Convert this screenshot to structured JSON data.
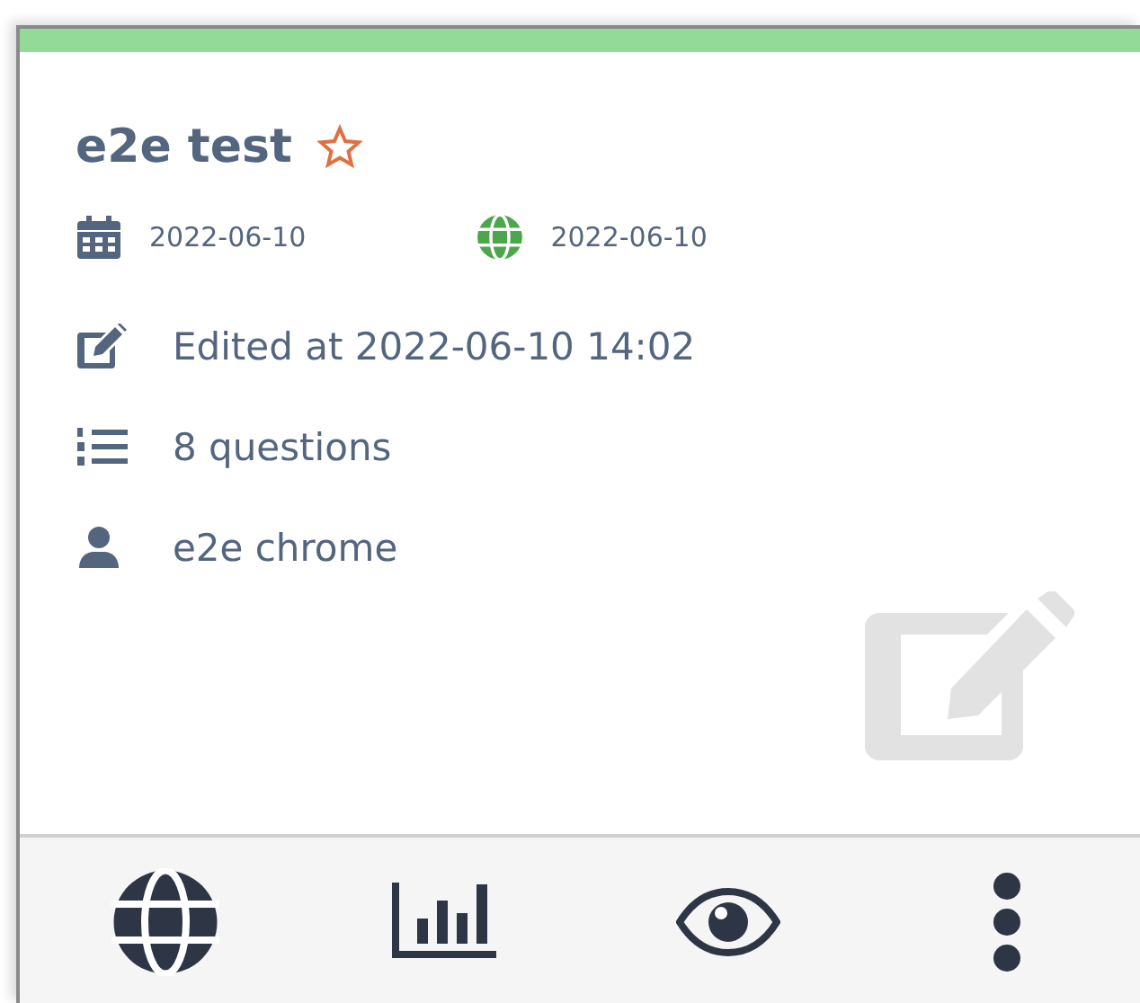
{
  "card": {
    "title": "e2e test",
    "starred": false,
    "published": true,
    "created_date": "2022-06-10",
    "published_date": "2022-06-10",
    "details": [
      {
        "kind": "edited",
        "text": "Edited at 2022-06-10 14:02"
      },
      {
        "kind": "questions",
        "text": "8 questions"
      },
      {
        "kind": "author",
        "text": "e2e chrome"
      }
    ],
    "actions": [
      {
        "kind": "publish"
      },
      {
        "kind": "stats"
      },
      {
        "kind": "preview"
      },
      {
        "kind": "more"
      }
    ]
  }
}
